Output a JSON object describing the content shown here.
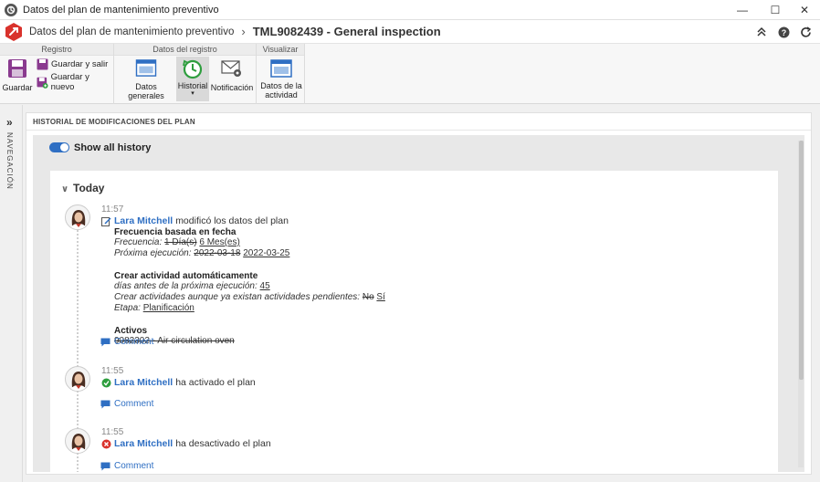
{
  "window": {
    "title": "Datos del plan de mantenimiento preventivo",
    "minimize": "—",
    "maximize": "☐",
    "close": "✕"
  },
  "header": {
    "breadcrumb": "Datos del plan de mantenimiento preventivo",
    "separator": "›",
    "record": "TML9082439 - General inspection"
  },
  "ribbon": {
    "groups": [
      {
        "title": "Registro"
      },
      {
        "title": "Datos del registro"
      },
      {
        "title": "Visualizar"
      }
    ],
    "save": "Guardar",
    "save_exit": "Guardar y salir",
    "save_new": "Guardar y nuevo",
    "general_data": "Datos generales",
    "history": "Historial",
    "notification": "Notificación",
    "activity_data_1": "Datos de la",
    "activity_data_2": "actividad"
  },
  "nav": {
    "label": "NAVEGACIÓN"
  },
  "panel": {
    "title": "HISTORIAL DE MODIFICACIONES DEL PLAN",
    "show_all_label": "Show all history",
    "show_all_on": true,
    "section": "Today"
  },
  "entries": [
    {
      "time": "11:57",
      "user": "Lara Mitchell",
      "action": "modificó los datos del plan",
      "b1_title": "Frecuencia basada en fecha",
      "b1_l1_label": "Frecuencia:",
      "b1_l1_old": "1 Día(s)",
      "b1_l1_new": "6 Mes(es)",
      "b1_l2_label": "Próxima ejecución:",
      "b1_l2_old": "2022-03-18",
      "b1_l2_new": "2022-03-25",
      "b2_title": "Crear actividad automáticamente",
      "b2_l1_label": "días antes de la próxima ejecución:",
      "b2_l1_new": "45",
      "b2_l2_label": "Crear actividades aunque ya existan actividades pendientes:",
      "b2_l2_old": "No",
      "b2_l2_new": "Sí",
      "b2_l3_label": "Etapa:",
      "b2_l3_new": "Planificación",
      "b3_title": "Activos",
      "b3_l1_old": "9082302 - Air circulation oven",
      "comment": "Comment"
    },
    {
      "time": "11:55",
      "user": "Lara Mitchell",
      "action": "ha activado el plan",
      "comment": "Comment"
    },
    {
      "time": "11:55",
      "user": "Lara Mitchell",
      "action": "ha desactivado el plan",
      "comment": "Comment"
    }
  ],
  "colors": {
    "accent": "#2f6fc3",
    "logo": "#d9322c",
    "success": "#2e9e3e",
    "danger": "#d9322c"
  }
}
